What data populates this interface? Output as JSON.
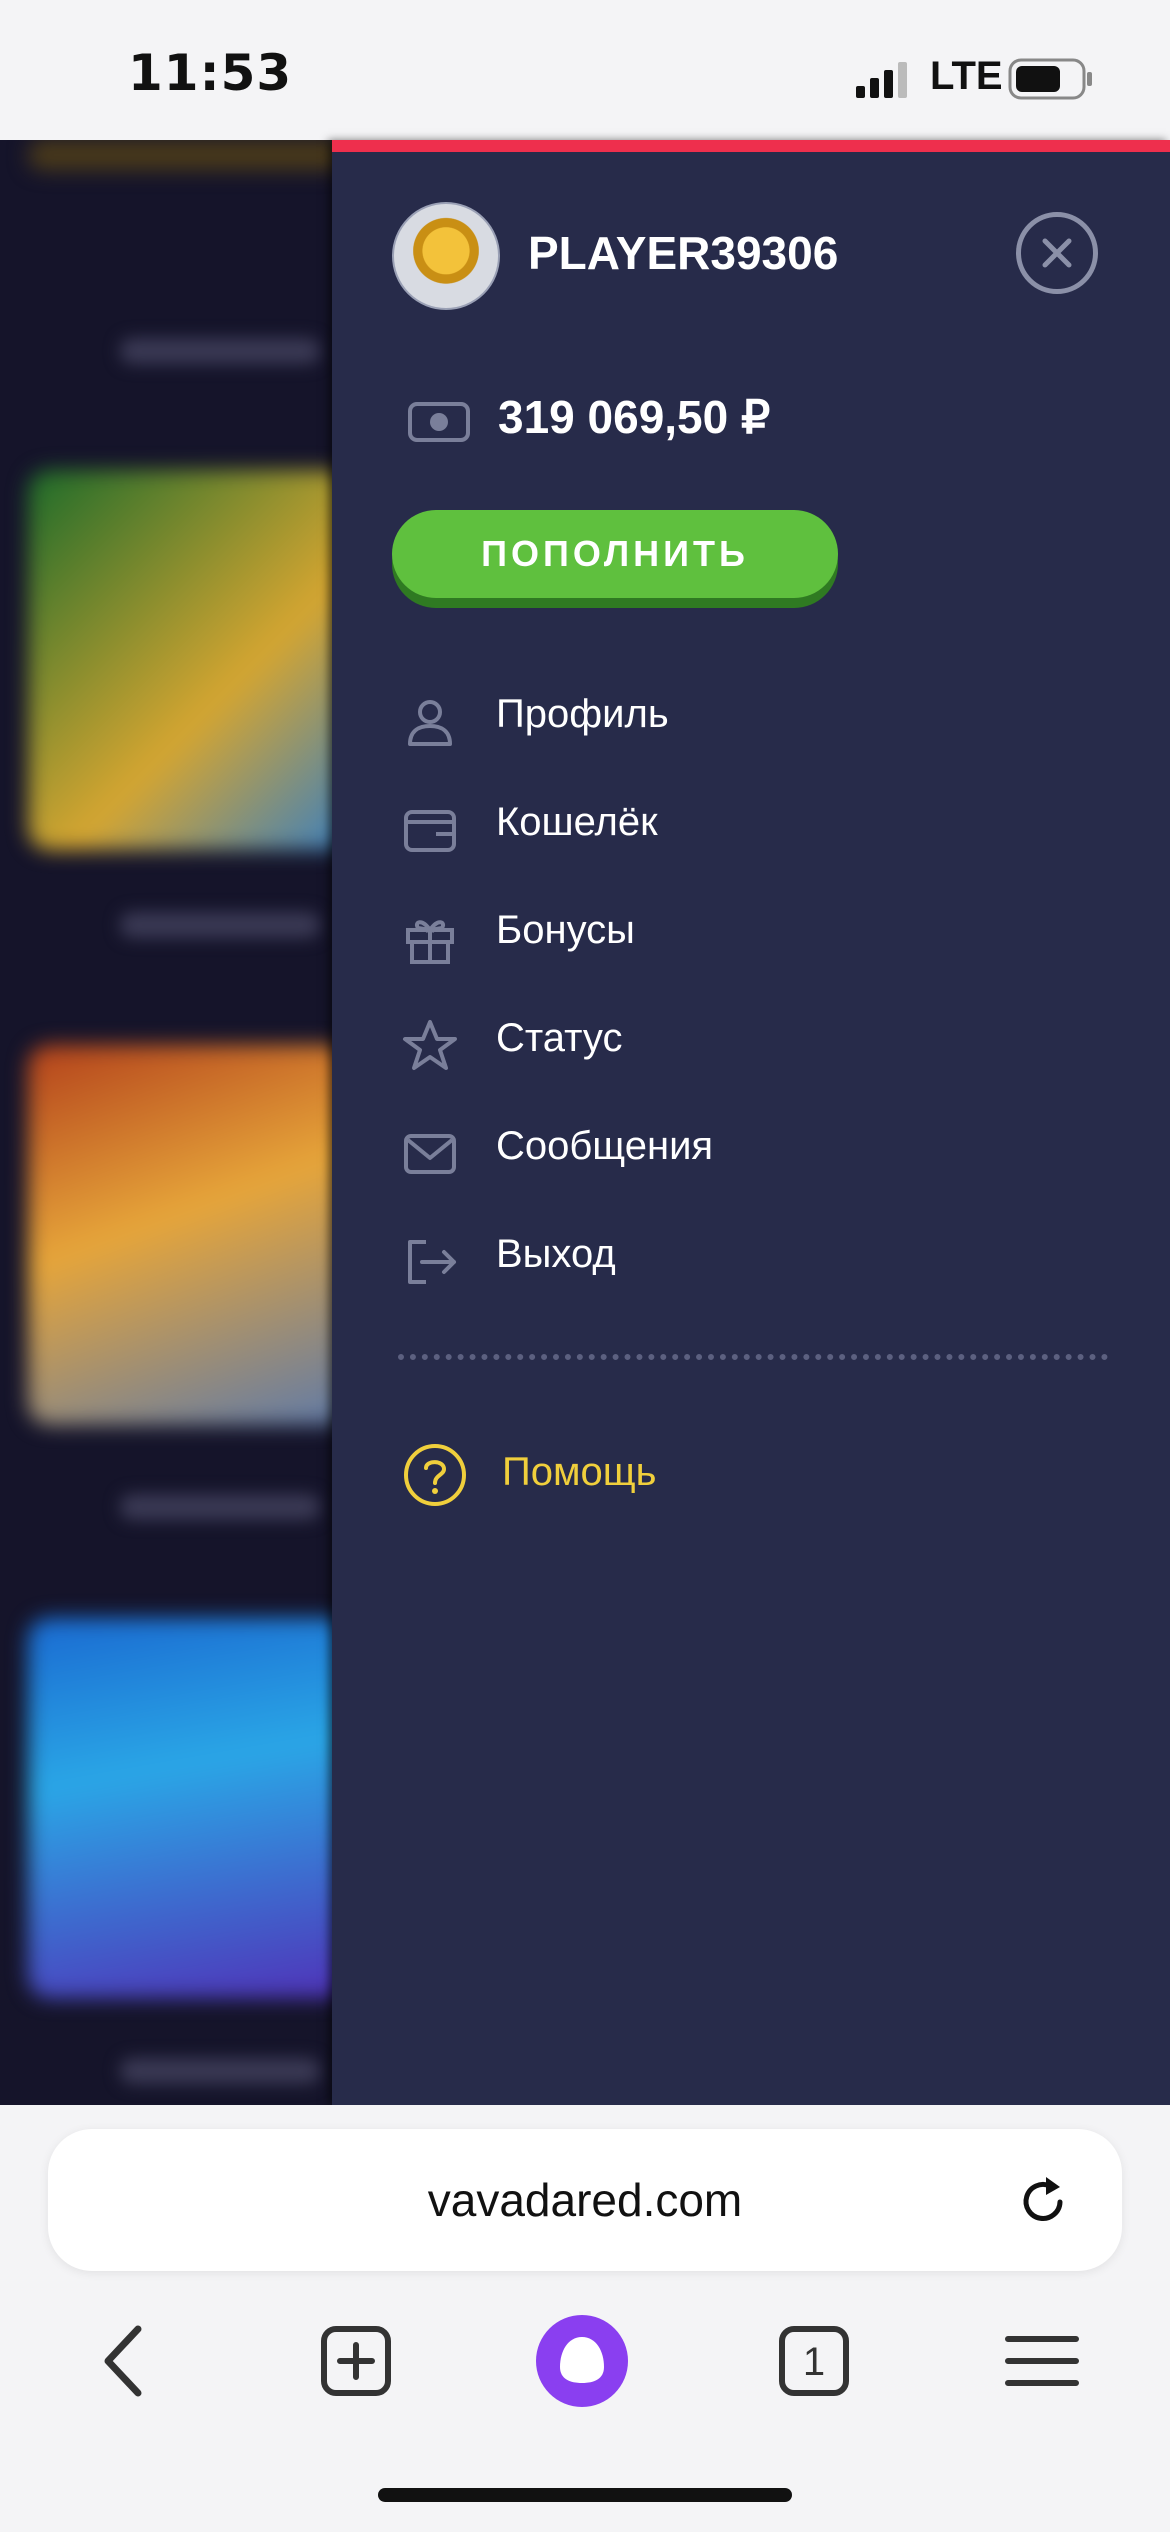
{
  "status_bar": {
    "time": "11:53",
    "network": "LTE"
  },
  "drawer": {
    "username": "PLAYER39306",
    "balance": "319 069,50 ₽",
    "deposit_label": "ПОПОЛНИТЬ",
    "menu": [
      {
        "icon": "user-icon",
        "label": "Профиль"
      },
      {
        "icon": "wallet-icon",
        "label": "Кошелёк"
      },
      {
        "icon": "gift-icon",
        "label": "Бонусы"
      },
      {
        "icon": "star-icon",
        "label": "Статус"
      },
      {
        "icon": "envelope-icon",
        "label": "Сообщения"
      },
      {
        "icon": "logout-icon",
        "label": "Выход"
      }
    ],
    "help_label": "Помощь"
  },
  "browser": {
    "url": "vavadared.com",
    "tab_count": "1"
  },
  "colors": {
    "drawer_bg": "#272b4a",
    "accent_red": "#ee2f4d",
    "deposit_green": "#5fc03e",
    "help_yellow": "#f0cf3c"
  }
}
